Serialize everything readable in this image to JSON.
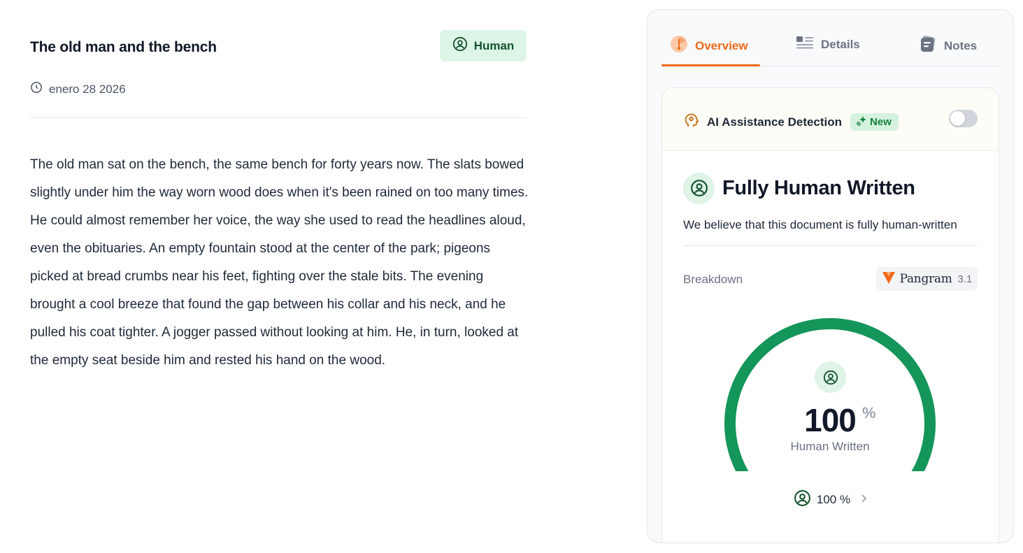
{
  "document": {
    "title": "The old man and the bench",
    "badge_label": "Human",
    "date": "enero 28 2026",
    "body": "The old man sat on the bench, the same bench for forty years now. The slats bowed slightly under him the way worn wood does when it's been rained on too many times. He could almost remember her voice, the way she used to read the headlines aloud, even the obituaries. An empty fountain stood at the center of the park; pigeons picked at bread crumbs near his feet, fighting over the stale bits. The evening brought a cool breeze that found the gap between his collar and his neck, and he pulled his coat tighter. A jogger passed without looking at him. He, in turn, looked at the empty seat beside him and rested his hand on the wood."
  },
  "tabs": [
    {
      "label": "Overview",
      "icon": "gauge-icon",
      "active": true
    },
    {
      "label": "Details",
      "icon": "list-icon",
      "active": false
    },
    {
      "label": "Notes",
      "icon": "notes-icon",
      "active": false
    }
  ],
  "ai_detection": {
    "title": "AI Assistance Detection",
    "new_badge": "New",
    "toggle_on": false
  },
  "result": {
    "title": "Fully Human Written",
    "description": "We believe that this document is fully human-written"
  },
  "breakdown": {
    "label": "Breakdown",
    "model_name": "Pangram",
    "model_version": "3.1"
  },
  "gauge": {
    "value": "100",
    "unit": "%",
    "label": "Human Written",
    "fraction": 1.0
  },
  "footer_stat": {
    "value": "100 %"
  },
  "colors": {
    "accent": "#ea6a18",
    "human_green": "#14955a",
    "badge_bg": "#dcf5e6"
  }
}
